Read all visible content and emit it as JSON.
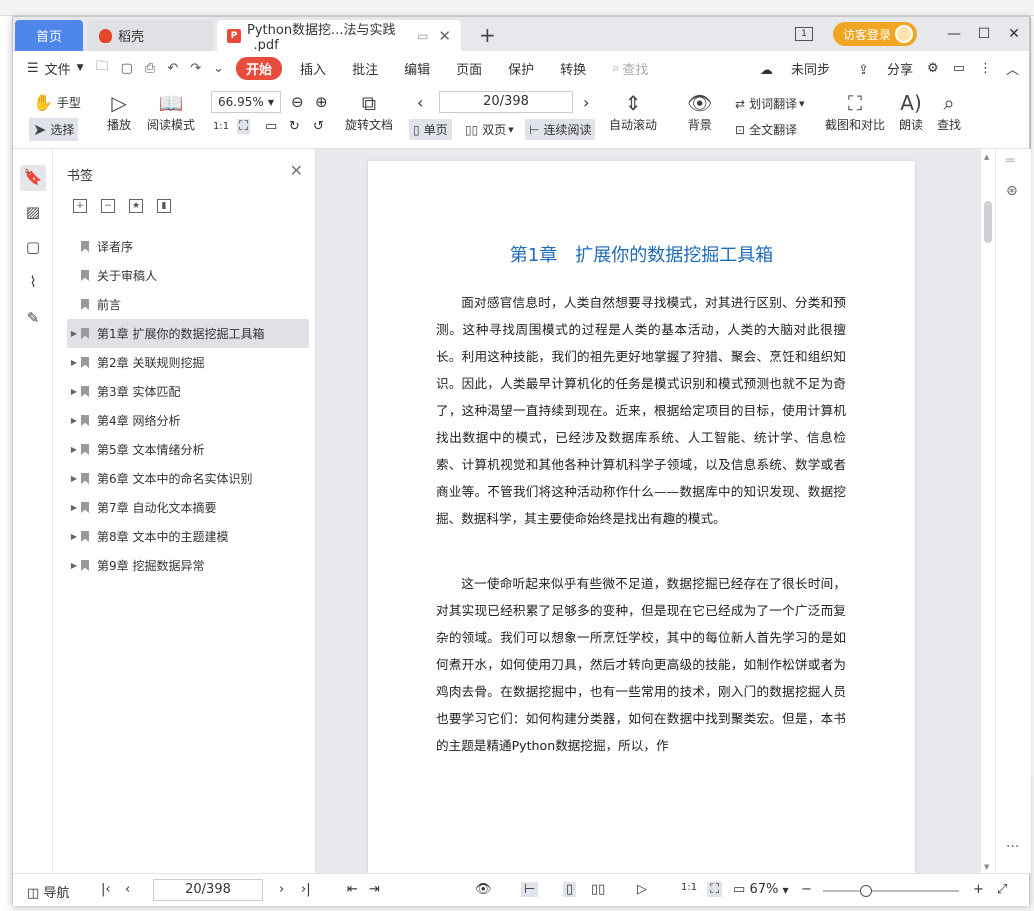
{
  "tabs": {
    "home": "首页",
    "daoke": "稻壳",
    "pdf": "Python数据挖...法与实践_.pdf",
    "new_tab": "+"
  },
  "titlebar": {
    "visitor_login": "访客登录",
    "minimize": "—",
    "maximize": "☐",
    "close": "✕"
  },
  "menu": {
    "file": "文件",
    "start": "开始",
    "insert": "插入",
    "annotate": "批注",
    "edit": "编辑",
    "page": "页面",
    "protect": "保护",
    "convert": "转换",
    "search_placeholder": "查找",
    "sync": "未同步",
    "share": "分享"
  },
  "toolbar": {
    "hand": "手型",
    "select": "选择",
    "play": "播放",
    "read_mode": "阅读模式",
    "zoom": "66.95%",
    "rotate": "旋转文档",
    "page_indicator": "20/398",
    "single": "单页",
    "double": "双页",
    "continuous": "连续阅读",
    "auto_scroll": "自动滚动",
    "background": "背景",
    "word_translate": "划词翻译",
    "full_translate": "全文翻译",
    "screenshot_compare": "截图和对比",
    "read_aloud": "朗读",
    "find": "查找"
  },
  "bookmarks": {
    "title": "书签",
    "items": [
      {
        "label": "译者序",
        "expandable": false,
        "active": false
      },
      {
        "label": "关于审稿人",
        "expandable": false,
        "active": false
      },
      {
        "label": "前言",
        "expandable": false,
        "active": false
      },
      {
        "label": "第1章 扩展你的数据挖掘工具箱",
        "expandable": true,
        "active": true
      },
      {
        "label": "第2章 关联规则挖掘",
        "expandable": true,
        "active": false
      },
      {
        "label": "第3章 实体匹配",
        "expandable": true,
        "active": false
      },
      {
        "label": "第4章 网络分析",
        "expandable": true,
        "active": false
      },
      {
        "label": "第5章 文本情绪分析",
        "expandable": true,
        "active": false
      },
      {
        "label": "第6章 文本中的命名实体识别",
        "expandable": true,
        "active": false
      },
      {
        "label": "第7章 自动化文本摘要",
        "expandable": true,
        "active": false
      },
      {
        "label": "第8章 文本中的主题建模",
        "expandable": true,
        "active": false
      },
      {
        "label": "第9章 挖掘数据异常",
        "expandable": true,
        "active": false
      }
    ]
  },
  "document": {
    "chapter_title": "第1章　扩展你的数据挖掘工具箱",
    "paragraph1": "面对感官信息时，人类自然想要寻找模式，对其进行区别、分类和预测。这种寻找周围模式的过程是人类的基本活动，人类的大脑对此很擅长。利用这种技能，我们的祖先更好地掌握了狩猎、聚会、烹饪和组织知识。因此，人类最早计算机化的任务是模式识别和模式预测也就不足为奇了，这种渴望一直持续到现在。近来，根据给定项目的目标，使用计算机找出数据中的模式，已经涉及数据库系统、人工智能、统计学、信息检索、计算机视觉和其他各种计算机科学子领域，以及信息系统、数学或者商业等。不管我们将这种活动称作什么——数据库中的知识发现、数据挖掘、数据科学，其主要使命始终是找出有趣的模式。",
    "paragraph2": "这一使命听起来似乎有些微不足道，数据挖掘已经存在了很长时间，对其实现已经积累了足够多的变种，但是现在它已经成为了一个广泛而复杂的领域。我们可以想象一所烹饪学校，其中的每位新人首先学习的是如何煮开水，如何使用刀具，然后才转向更高级的技能，如制作松饼或者为鸡肉去骨。在数据挖掘中，也有一些常用的技术，刚入门的数据挖掘人员也要学习它们：如何构建分类器，如何在数据中找到聚类宏。但是，本书的主题是精通Python数据挖掘，所以，作"
  },
  "statusbar": {
    "nav": "导航",
    "page_indicator": "20/398",
    "zoom": "67%",
    "zoom_level": 0.3
  }
}
